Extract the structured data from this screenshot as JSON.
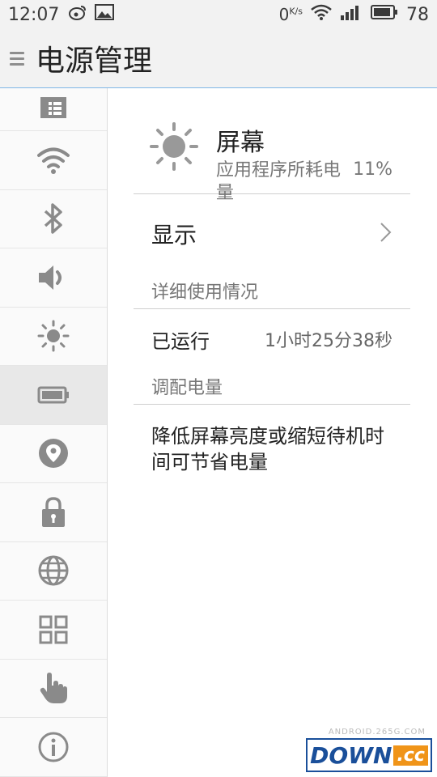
{
  "status_bar": {
    "time": "12:07",
    "left_icons": [
      "weibo-icon",
      "image-icon"
    ],
    "speed_value": "0",
    "speed_unit": "K/s",
    "battery": "78"
  },
  "header": {
    "title": "电源管理"
  },
  "sidebar": {
    "items": [
      {
        "icon": "sim-card-icon",
        "active": false
      },
      {
        "icon": "wifi-icon",
        "active": false
      },
      {
        "icon": "bluetooth-icon",
        "active": false
      },
      {
        "icon": "volume-icon",
        "active": false
      },
      {
        "icon": "brightness-icon",
        "active": false
      },
      {
        "icon": "battery-icon",
        "active": true
      },
      {
        "icon": "location-icon",
        "active": false
      },
      {
        "icon": "lock-icon",
        "active": false
      },
      {
        "icon": "globe-icon",
        "active": false
      },
      {
        "icon": "apps-grid-icon",
        "active": false
      },
      {
        "icon": "hand-gesture-icon",
        "active": false
      },
      {
        "icon": "info-icon",
        "active": false
      }
    ]
  },
  "main": {
    "app": {
      "name": "屏幕",
      "subtitle": "应用程序所耗电量",
      "percent": "11%",
      "icon": "sun-icon"
    },
    "display_row": {
      "label": "显示"
    },
    "usage_section": {
      "title": "详细使用情况",
      "run_label": "已运行",
      "run_value": "1小时25分38秒"
    },
    "adjust_section": {
      "title": "调配电量",
      "tip": "降低屏幕亮度或缩短待机时间可节省电量"
    }
  },
  "watermark": {
    "top_text": "ANDROID.265G.COM",
    "brand": "DOWN",
    "suffix": ".cc"
  },
  "colors": {
    "accent_line": "#7fb6e6",
    "icon_gray": "#8a8a8a",
    "active_bg": "#e8e8e8"
  }
}
